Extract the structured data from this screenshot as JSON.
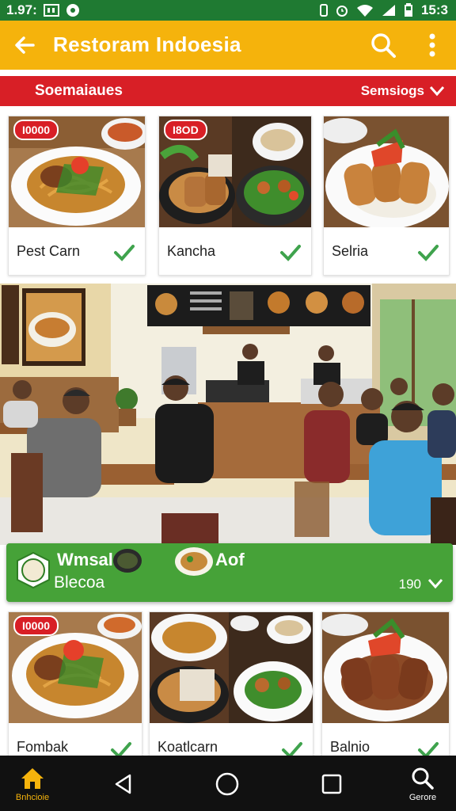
{
  "status_bar": {
    "time_left": "1.97:",
    "time_right": "15:3"
  },
  "app_bar": {
    "title": "Restoram Indoesia"
  },
  "filter_bar": {
    "left_label": "Soemaiaues",
    "right_label": "Semsiogs"
  },
  "cards_top": [
    {
      "tag": "I0000",
      "name": "Pest Carn"
    },
    {
      "tag": "I8OD",
      "name": "Kancha"
    },
    {
      "tag": "",
      "name": "Selria"
    }
  ],
  "banner": {
    "title": "Wmsalan",
    "subtitle": "Blecoa",
    "label": "Aof",
    "count": "190"
  },
  "cards_bottom": [
    {
      "tag": "I0000",
      "name": "Fombak"
    },
    {
      "tag": "",
      "name": "Koatlcarn"
    },
    {
      "tag": "",
      "name": "Balnio"
    }
  ],
  "nav": {
    "home_label": "Bnhcioie",
    "search_label": "Gerore"
  },
  "colors": {
    "accent": "#f5b30c",
    "red": "#d81f26",
    "green": "#46a238",
    "status": "#1f7a32"
  }
}
